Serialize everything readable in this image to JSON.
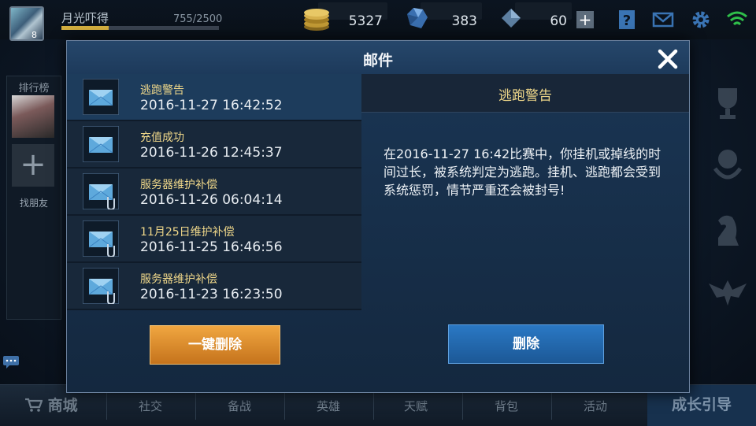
{
  "player": {
    "name": "月光吓得",
    "level": "8",
    "xp_text": "755/2500",
    "xp_fraction": 0.302
  },
  "resources": {
    "gold": "5327",
    "diamond": "383",
    "crystal": "60"
  },
  "left_panel": {
    "rank_label": "排行榜",
    "find_friend_label": "找朋友"
  },
  "bottom_nav": {
    "shop": "商城",
    "items": [
      "社交",
      "备战",
      "英雄",
      "天赋",
      "背包",
      "活动"
    ],
    "guide": "成长引导"
  },
  "modal": {
    "title": "邮件",
    "mails": [
      {
        "subject": "逃跑警告",
        "time": "2016-11-27 16:42:52",
        "attachment": false,
        "selected": true
      },
      {
        "subject": "充值成功",
        "time": "2016-11-26 12:45:37",
        "attachment": false,
        "selected": false
      },
      {
        "subject": "服务器维护补偿",
        "time": "2016-11-26 06:04:14",
        "attachment": true,
        "selected": false
      },
      {
        "subject": "11月25日维护补偿",
        "time": "2016-11-25 16:46:56",
        "attachment": true,
        "selected": false
      },
      {
        "subject": "服务器维护补偿",
        "time": "2016-11-23 16:23:50",
        "attachment": true,
        "selected": false
      }
    ],
    "detail": {
      "title": "逃跑警告",
      "body": "在2016-11-27 16:42比赛中，你挂机或掉线的时间过长，被系统判定为逃跑。挂机、逃跑都会受到系统惩罚，情节严重还会被封号!"
    },
    "delete_all_label": "一键删除",
    "delete_label": "删除"
  },
  "colors": {
    "accent_gold": "#f0d88a",
    "delete_all": "#e0902e",
    "delete": "#2468ad"
  },
  "icons": [
    "gold-coin-icon",
    "diamond-icon",
    "crystal-icon",
    "plus-icon",
    "help-icon",
    "mail-icon",
    "gear-icon",
    "wifi-icon",
    "close-icon",
    "envelope-icon",
    "paperclip-icon",
    "trophy-icon",
    "medal-icon",
    "chess-knight-icon",
    "eagle-icon",
    "cart-icon",
    "chat-icon"
  ]
}
